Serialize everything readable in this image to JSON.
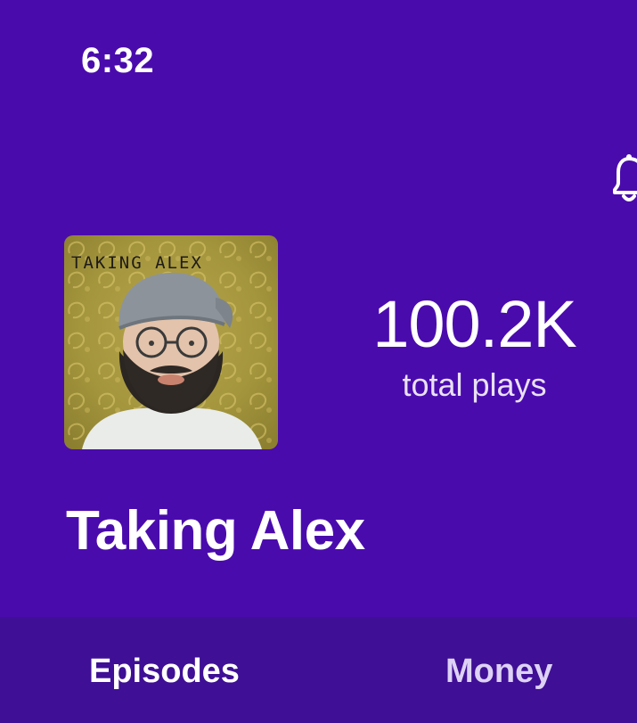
{
  "status_bar": {
    "time": "6:32"
  },
  "header": {
    "notification_icon": "bell-icon"
  },
  "podcast": {
    "cover_text": "TAKING ALEX",
    "title": "Taking Alex",
    "total_plays": "100.2K",
    "total_plays_label": "total plays"
  },
  "tabs": [
    {
      "label": "Episodes",
      "active": true
    },
    {
      "label": "Money",
      "active": false
    }
  ],
  "colors": {
    "background": "#4a0bad",
    "tab_bar": "#3f0f95",
    "text": "#ffffff"
  }
}
